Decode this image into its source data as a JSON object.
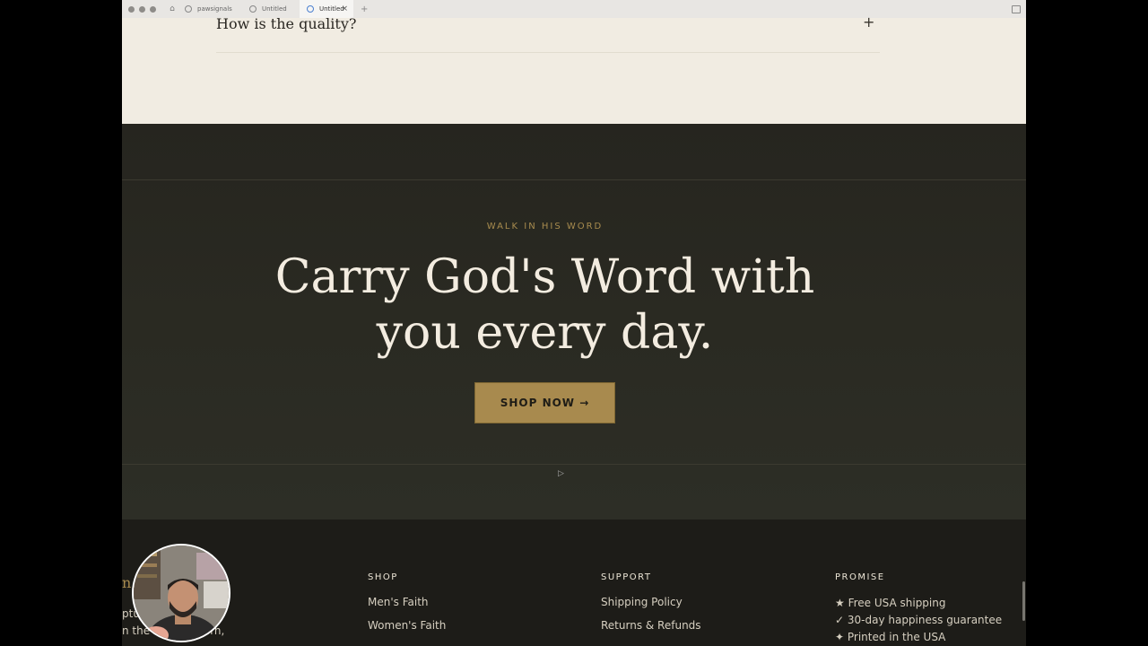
{
  "browser": {
    "tabs": [
      {
        "label": "pawsignals"
      },
      {
        "label": "Untitled"
      },
      {
        "label": "Untitled",
        "active": true
      }
    ],
    "new_tab": "+",
    "close": "×"
  },
  "faq": {
    "question": "How is the quality?",
    "toggle": "+"
  },
  "hero": {
    "eyebrow": "WALK IN HIS WORD",
    "headline_line1": "Carry God's Word with",
    "headline_line2": "you every day.",
    "cta_label": "SHOP NOW →"
  },
  "footer": {
    "brand_fragment": "n",
    "description_line1": "ptur         d and",
    "description_line2": "n the b         to be worn,",
    "shop": {
      "heading": "SHOP",
      "links": [
        "Men's Faith",
        "Women's Faith"
      ]
    },
    "support": {
      "heading": "SUPPORT",
      "links": [
        "Shipping Policy",
        "Returns & Refunds"
      ]
    },
    "promise": {
      "heading": "PROMISE",
      "items": [
        "★ Free USA shipping",
        "✓ 30-day happiness guarantee",
        "✦ Printed in the USA"
      ]
    }
  },
  "colors": {
    "accent_gold": "#a88a4e",
    "hero_bg": "#28271f",
    "cream_bg": "#f1ece2",
    "footer_bg": "#1d1c18"
  }
}
